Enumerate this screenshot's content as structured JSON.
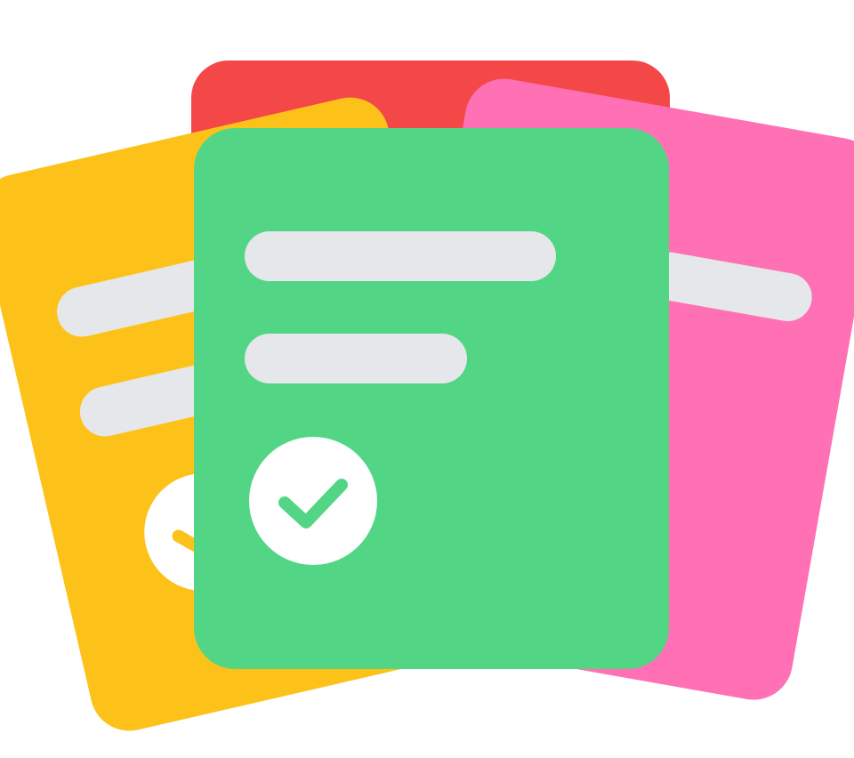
{
  "icon": {
    "name": "stacked-notes-checklist-icon",
    "cards": [
      {
        "name": "back-card",
        "color": "#F44848"
      },
      {
        "name": "left-card",
        "color": "#FDC21A"
      },
      {
        "name": "right-card",
        "color": "#FF70B4"
      },
      {
        "name": "front-card",
        "color": "#52D685"
      }
    ],
    "line_color": "#E6E7EA",
    "check_circle_color": "#FFFFFF",
    "check_mark_color": "#52D685",
    "left_check_mark_color": "#FDC21A"
  }
}
